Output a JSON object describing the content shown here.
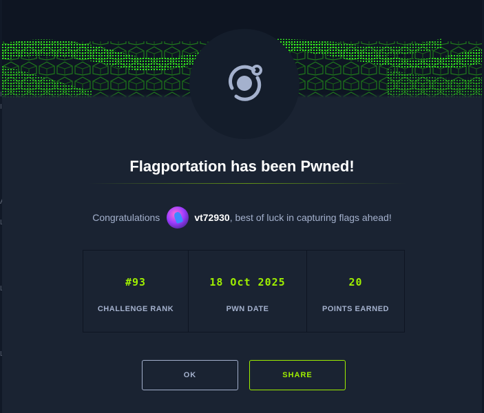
{
  "modal": {
    "title": "Flagportation has been Pwned!",
    "congrats_prefix": "Congratulations",
    "username": "vt72930",
    "congrats_suffix": ", best of luck in capturing flags ahead!",
    "stats": [
      {
        "value": "#93",
        "label": "CHALLENGE RANK"
      },
      {
        "value": "18 Oct 2025",
        "label": "PWN DATE"
      },
      {
        "value": "20",
        "label": "POINTS EARNED"
      }
    ],
    "buttons": {
      "ok": "OK",
      "share": "SHARE"
    },
    "icons": {
      "emblem": "challenge-emblem-icon",
      "avatar": "user-avatar"
    },
    "colors": {
      "accent": "#9fef00",
      "background": "#1a2332",
      "muted_text": "#a4b1cd"
    }
  },
  "backdrop": {
    "edge_marks": [
      "I",
      "I",
      "A",
      "L",
      "L",
      "L"
    ]
  }
}
